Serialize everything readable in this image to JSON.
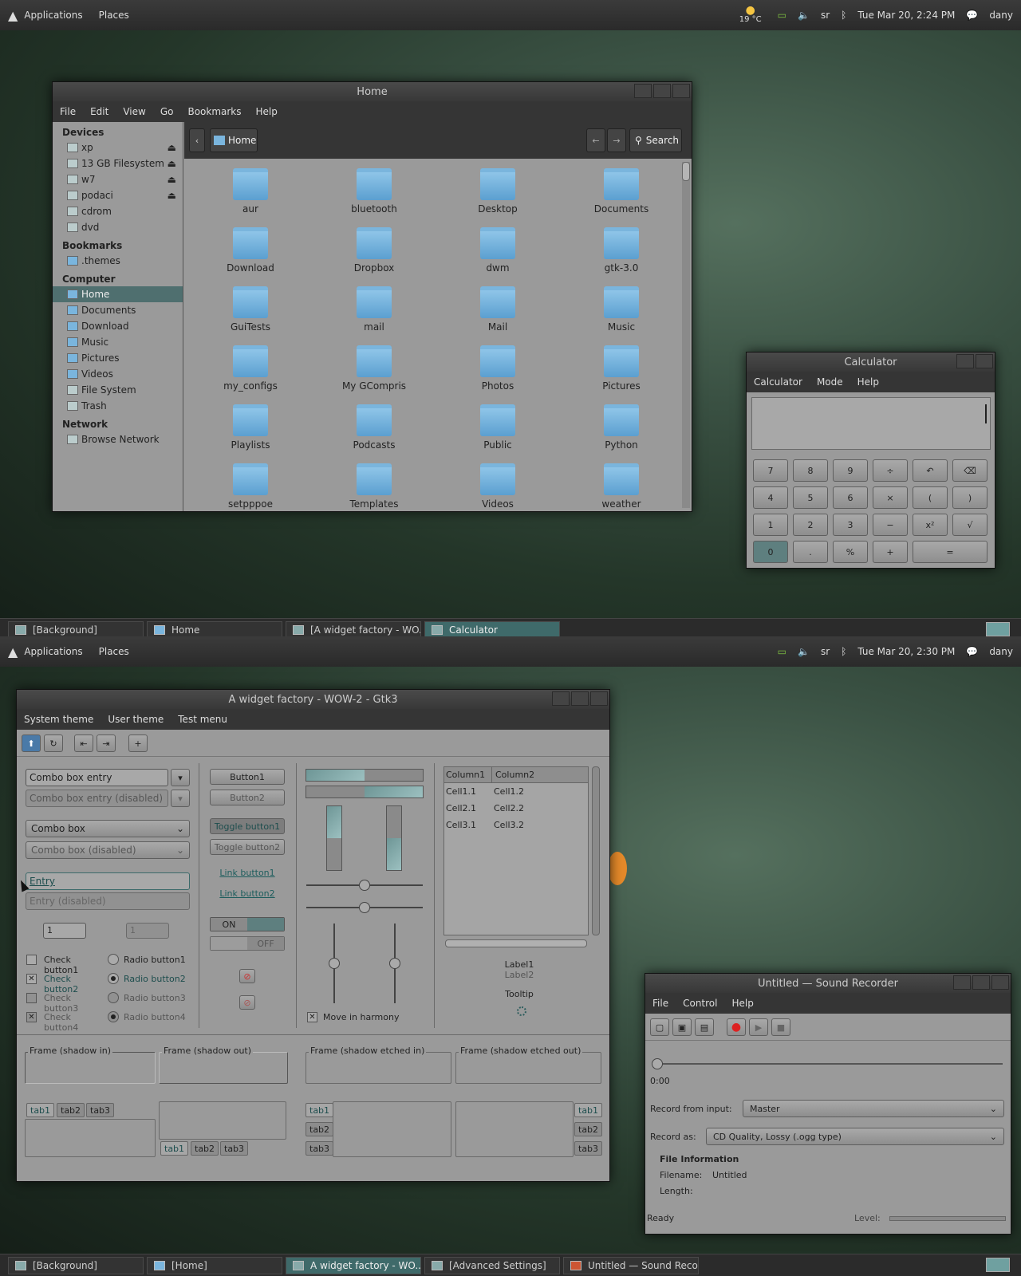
{
  "top_screen": {
    "topbar": {
      "applications": "Applications",
      "places": "Places",
      "weather": "19 °C",
      "kbd": "sr",
      "datetime": "Tue Mar 20,  2:24 PM",
      "user": "dany"
    },
    "file_manager": {
      "title": "Home",
      "menu": [
        "File",
        "Edit",
        "View",
        "Go",
        "Bookmarks",
        "Help"
      ],
      "location": "Home",
      "search_label": "Search",
      "sidebar": {
        "devices_header": "Devices",
        "devices": [
          "xp",
          "13 GB Filesystem",
          "w7",
          "podaci",
          "cdrom",
          "dvd"
        ],
        "bookmarks_header": "Bookmarks",
        "bookmarks": [
          ".themes"
        ],
        "computer_header": "Computer",
        "computer": [
          "Home",
          "Documents",
          "Download",
          "Music",
          "Pictures",
          "Videos",
          "File System",
          "Trash"
        ],
        "network_header": "Network",
        "network": [
          "Browse Network"
        ]
      },
      "files": [
        "aur",
        "bluetooth",
        "Desktop",
        "Documents",
        "Download",
        "Dropbox",
        "dwm",
        "gtk-3.0",
        "GuiTests",
        "mail",
        "Mail",
        "Music",
        "my_configs",
        "My GCompris",
        "Photos",
        "Pictures",
        "Playlists",
        "Podcasts",
        "Public",
        "Python",
        "setpppoe",
        "Templates",
        "Videos",
        "weather"
      ]
    },
    "calculator": {
      "title": "Calculator",
      "menu": [
        "Calculator",
        "Mode",
        "Help"
      ],
      "rows": [
        [
          "7",
          "8",
          "9",
          "÷",
          "↶",
          "⌫"
        ],
        [
          "4",
          "5",
          "6",
          "×",
          "(",
          ")"
        ],
        [
          "1",
          "2",
          "3",
          "−",
          "x²",
          "√"
        ],
        [
          "0",
          ".",
          "%",
          "+",
          "="
        ]
      ]
    },
    "taskbar": [
      "[Background]",
      "Home",
      "[A widget factory - WO...",
      "Calculator"
    ]
  },
  "bottom_screen": {
    "topbar": {
      "applications": "Applications",
      "places": "Places",
      "kbd": "sr",
      "datetime": "Tue Mar 20,  2:30 PM",
      "user": "dany"
    },
    "widget_factory": {
      "title": "A widget factory - WOW-2 - Gtk3",
      "menu": [
        "System theme",
        "User theme",
        "Test menu"
      ],
      "combo_entry": "Combo box entry",
      "combo_entry_disabled": "Combo box entry (disabled)",
      "combo": "Combo box",
      "combo_disabled": "Combo box (disabled)",
      "entry": "Entry",
      "entry_disabled": "Entry (disabled)",
      "spin1": "1",
      "spin2": "1",
      "checks": [
        "Check button1",
        "Check button2",
        "Check button3",
        "Check button4"
      ],
      "radios": [
        "Radio button1",
        "Radio button2",
        "Radio button3",
        "Radio button4"
      ],
      "buttons": [
        "Button1",
        "Button2",
        "Toggle button1",
        "Toggle button2"
      ],
      "links": [
        "Link button1",
        "Link button2"
      ],
      "switch_on": "ON",
      "switch_off": "OFF",
      "progress_h": [
        0.5,
        0.5
      ],
      "progress_v": [
        0.5,
        0.5
      ],
      "slider_h": [
        0.5,
        0.5
      ],
      "slider_v": [
        0.5,
        0.5
      ],
      "harmony": "Move in harmony",
      "tree": {
        "columns": [
          "Column1",
          "Column2"
        ],
        "rows": [
          [
            "Cell1.1",
            "Cell1.2"
          ],
          [
            "Cell2.1",
            "Cell2.2"
          ],
          [
            "Cell3.1",
            "Cell3.2"
          ]
        ]
      },
      "label1": "Label1",
      "label2": "Label2",
      "tooltip": "Tooltip",
      "frames": [
        "Frame (shadow in)",
        "Frame (shadow out)",
        "Frame (shadow etched in)",
        "Frame (shadow etched out)"
      ],
      "tabs": [
        "tab1",
        "tab2",
        "tab3"
      ]
    },
    "sound_recorder": {
      "title": "Untitled — Sound Recorder",
      "menu": [
        "File",
        "Control",
        "Help"
      ],
      "time": "0:00",
      "record_from_label": "Record from input:",
      "record_from": "Master",
      "record_as_label": "Record as:",
      "record_as": "CD Quality, Lossy (.ogg type)",
      "info_header": "File Information",
      "filename_label": "Filename:",
      "filename": "Untitled",
      "length_label": "Length:",
      "status": "Ready",
      "level_label": "Level:"
    },
    "taskbar": [
      "[Background]",
      "[Home]",
      "A widget factory - WO...",
      "[Advanced Settings]",
      "Untitled — Sound Reco..."
    ]
  }
}
